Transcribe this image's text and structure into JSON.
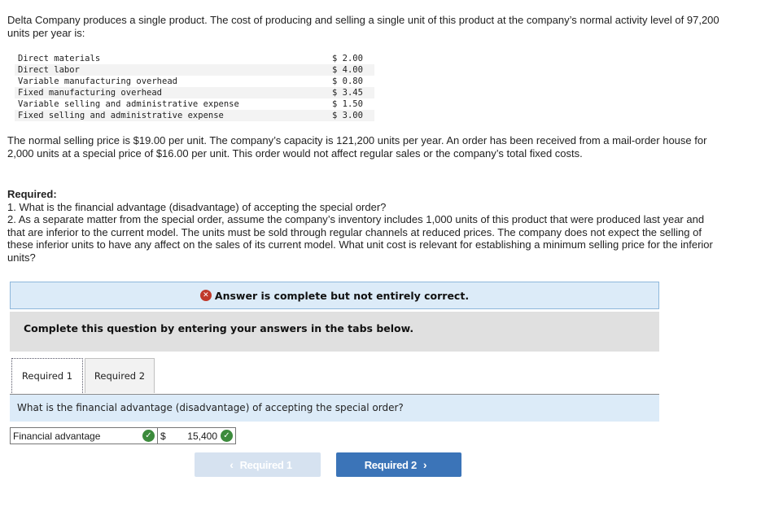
{
  "problem": {
    "intro": "Delta Company produces a single product. The cost of producing and selling a single unit of this product at the company’s normal activity level of 97,200 units per year is:",
    "costs": [
      {
        "label": "Direct materials",
        "amount": "$ 2.00"
      },
      {
        "label": "Direct labor",
        "amount": "$ 4.00"
      },
      {
        "label": "Variable manufacturing overhead",
        "amount": "$ 0.80"
      },
      {
        "label": "Fixed manufacturing overhead",
        "amount": "$ 3.45"
      },
      {
        "label": "Variable selling and administrative expense",
        "amount": "$ 1.50"
      },
      {
        "label": "Fixed selling and administrative expense",
        "amount": "$ 3.00"
      }
    ],
    "details": "The normal selling price is $19.00 per unit. The company’s capacity is 121,200 units per year. An order has been received from a mail-order house for 2,000 units at a special price of $16.00 per unit. This order would not affect regular sales or the company’s total fixed costs.",
    "required_heading": "Required:",
    "required_items": [
      "1. What is the financial advantage (disadvantage) of accepting the special order?",
      "2. As a separate matter from the special order, assume the company’s inventory includes 1,000 units of this product that were produced last year and that are inferior to the current model. The units must be sold through regular channels at reduced prices. The company does not expect the selling of these inferior units to have any affect on the sales of its current model. What unit cost is relevant for establishing a minimum selling price for the inferior units?"
    ]
  },
  "feedback": {
    "icon": "error-x-icon",
    "message": "Answer is complete but not entirely correct."
  },
  "instructions": "Complete this question by entering your answers in the tabs below.",
  "tabs": [
    {
      "label": "Required 1",
      "active": true
    },
    {
      "label": "Required 2",
      "active": false
    }
  ],
  "question": "What is the financial advantage (disadvantage) of accepting the special order?",
  "answer": {
    "label": "Financial advantage",
    "currency": "$",
    "value": "15,400",
    "label_status": "correct",
    "value_status": "correct"
  },
  "navigation": {
    "prev_label": "Required 1",
    "next_label": "Required 2",
    "prev_enabled": false,
    "next_enabled": true
  },
  "colors": {
    "banner_bg": "#dcebf8",
    "error": "#c0392b",
    "correct": "#3c8b3c",
    "primary_button": "#3b74b8",
    "disabled_button": "#d6e2f0"
  }
}
